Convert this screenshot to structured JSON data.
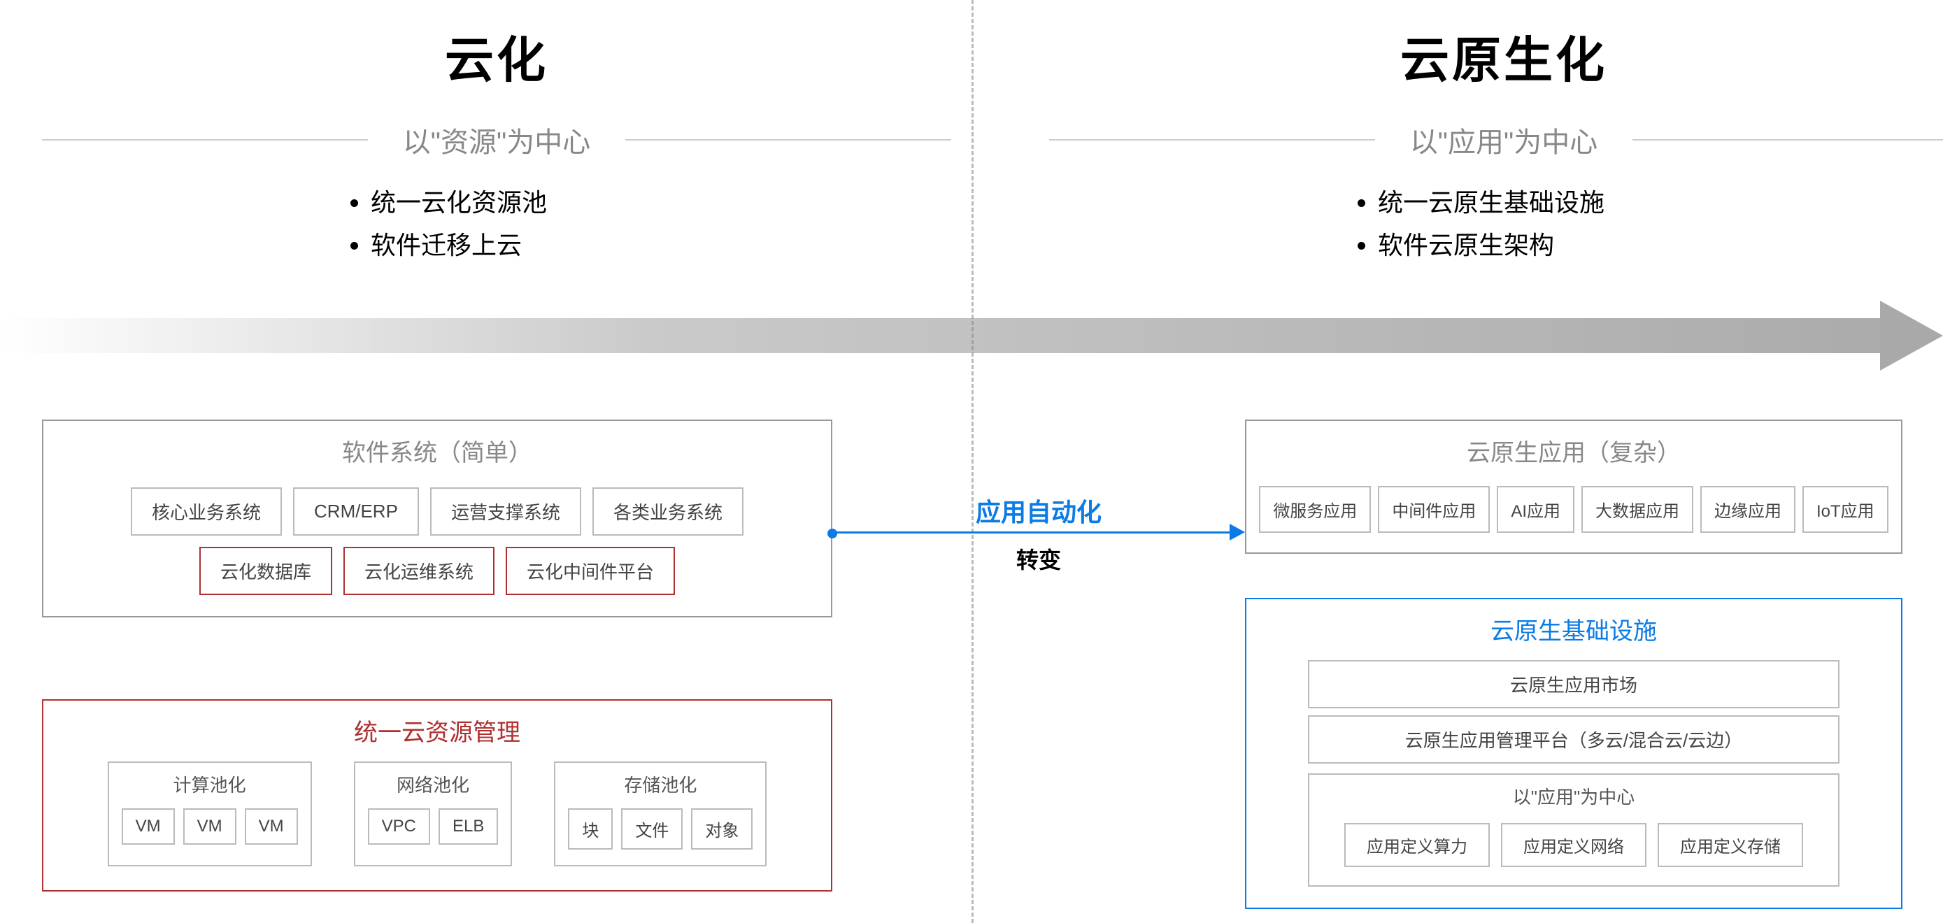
{
  "left": {
    "title": "云化",
    "subtitle": "以\"资源\"为中心",
    "bullets": [
      "统一云化资源池",
      "软件迁移上云"
    ]
  },
  "right": {
    "title": "云原生化",
    "subtitle": "以\"应用\"为中心",
    "bullets": [
      "统一云原生基础设施",
      "软件云原生架构"
    ]
  },
  "connector": {
    "top": "应用自动化",
    "bottom": "转变"
  },
  "swSys": {
    "title": "软件系统（简单）",
    "row1": [
      "核心业务系统",
      "CRM/ERP",
      "运营支撑系统",
      "各类业务系统"
    ],
    "row2": [
      "云化数据库",
      "云化运维系统",
      "云化中间件平台"
    ]
  },
  "cloudRes": {
    "title": "统一云资源管理",
    "groups": [
      {
        "title": "计算池化",
        "items": [
          "VM",
          "VM",
          "VM"
        ]
      },
      {
        "title": "网络池化",
        "items": [
          "VPC",
          "ELB"
        ]
      },
      {
        "title": "存储池化",
        "items": [
          "块",
          "文件",
          "对象"
        ]
      }
    ]
  },
  "cnApp": {
    "title": "云原生应用（复杂）",
    "items": [
      "微服务应用",
      "中间件应用",
      "AI应用",
      "大数据应用",
      "边缘应用",
      "IoT应用"
    ]
  },
  "cnInfra": {
    "title": "云原生基础设施",
    "marketplace": "云原生应用市场",
    "platform": "云原生应用管理平台（多云/混合云/云边）",
    "inner": {
      "title": "以\"应用\"为中心",
      "items": [
        "应用定义算力",
        "应用定义网络",
        "应用定义存储"
      ]
    }
  }
}
